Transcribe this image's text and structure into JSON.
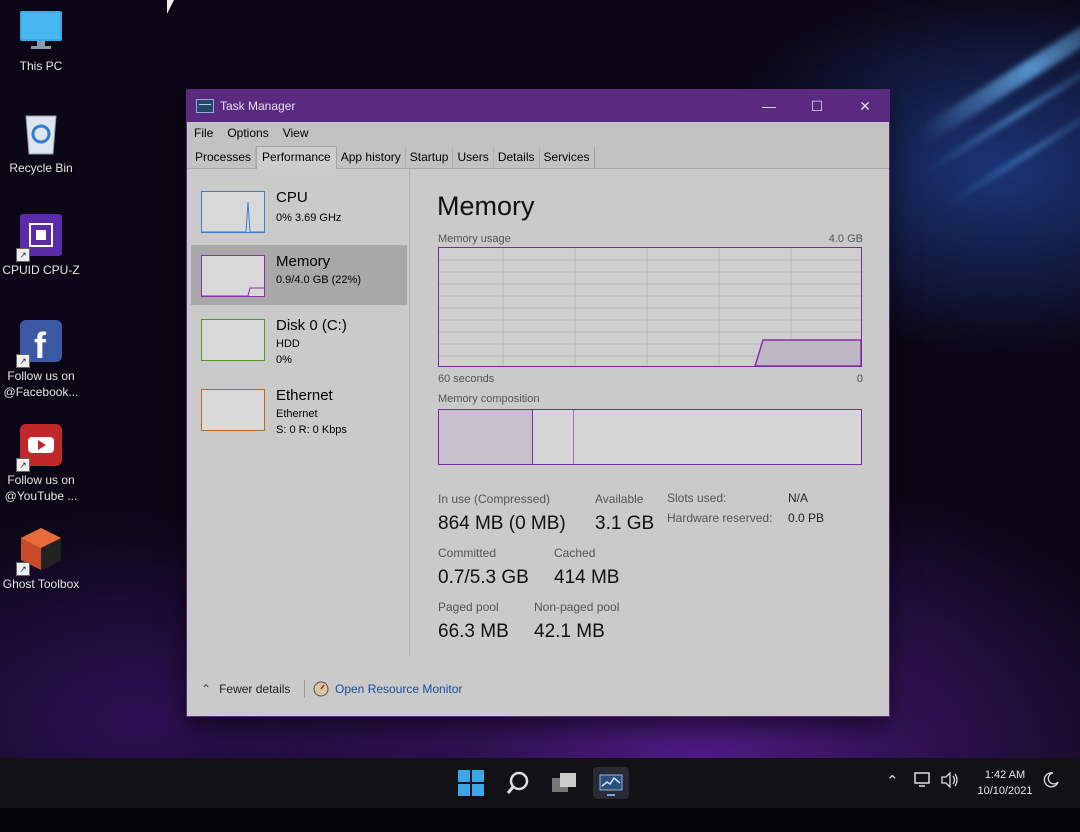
{
  "desktop": {
    "icons": [
      {
        "label": "This PC",
        "icon": "computer-monitor-icon"
      },
      {
        "label": "Recycle Bin",
        "icon": "recycle-bin-icon"
      },
      {
        "label": "CPUID CPU-Z",
        "icon": "cpu-chip-icon"
      },
      {
        "label": "Follow us on @Facebook...",
        "icon": "facebook-icon"
      },
      {
        "label": "Follow us on @YouTube ...",
        "icon": "youtube-icon"
      },
      {
        "label": "Ghost Toolbox",
        "icon": "ghost-toolbox-icon"
      }
    ]
  },
  "window": {
    "title": "Task Manager",
    "controls": {
      "minimize": "—",
      "maximize": "☐",
      "close": "✕"
    },
    "menu": [
      "File",
      "Options",
      "View"
    ],
    "tabs": [
      "Processes",
      "Performance",
      "App history",
      "Startup",
      "Users",
      "Details",
      "Services"
    ],
    "active_tab": "Performance",
    "resources": [
      {
        "name": "CPU",
        "line1": "0%  3.69 GHz",
        "line2": "",
        "color": "#3a7fc4"
      },
      {
        "name": "Memory",
        "line1": "0.9/4.0 GB (22%)",
        "line2": "",
        "color": "#8b2fa8"
      },
      {
        "name": "Disk 0 (C:)",
        "line1": "HDD",
        "line2": "0%",
        "color": "#4c9a2a"
      },
      {
        "name": "Ethernet",
        "line1": "Ethernet",
        "line2": "S: 0  R: 0 Kbps",
        "color": "#b86a22"
      }
    ],
    "selected_resource": "Memory",
    "detail": {
      "title": "Memory",
      "usage_label": "Memory usage",
      "usage_max": "4.0 GB",
      "axis_left": "60 seconds",
      "axis_right": "0",
      "composition_label": "Memory composition",
      "in_use_label": "In use (Compressed)",
      "in_use_value": "864 MB (0 MB)",
      "available_label": "Available",
      "available_value": "3.1 GB",
      "slots_label": "Slots used:",
      "slots_value": "N/A",
      "hw_reserved_label": "Hardware reserved:",
      "hw_reserved_value": "0.0 PB",
      "committed_label": "Committed",
      "committed_value": "0.7/5.3 GB",
      "cached_label": "Cached",
      "cached_value": "414 MB",
      "paged_label": "Paged pool",
      "paged_value": "66.3 MB",
      "nonpaged_label": "Non-paged pool",
      "nonpaged_value": "42.1 MB",
      "usage_fraction": 0.22
    },
    "footer": {
      "fewer_details": "Fewer details",
      "resource_monitor": "Open Resource Monitor"
    }
  },
  "taskbar": {
    "clock_time": "1:42 AM",
    "clock_date": "10/10/2021"
  }
}
